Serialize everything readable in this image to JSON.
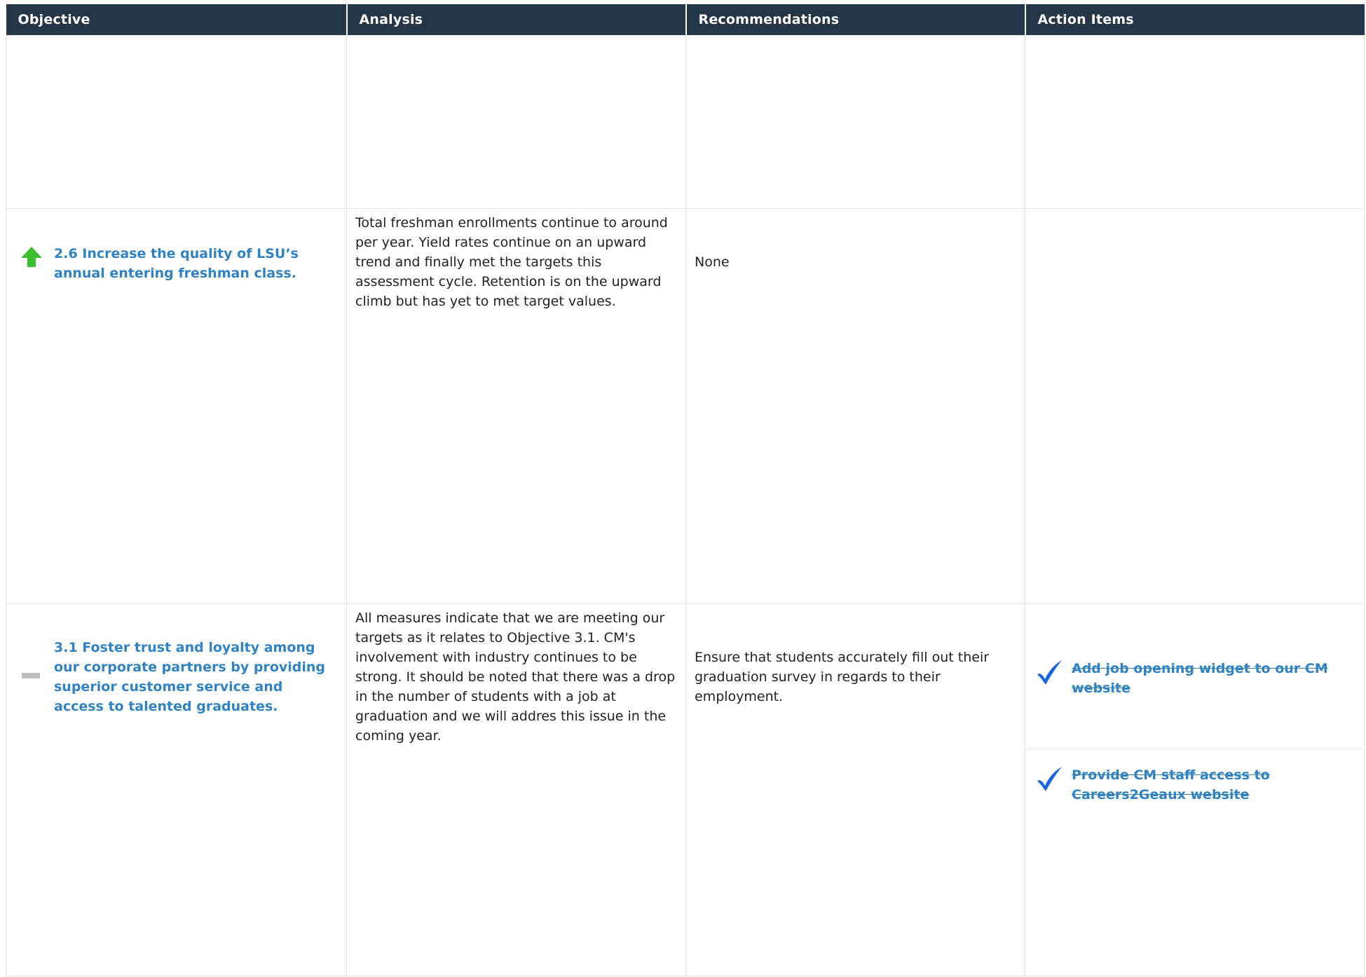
{
  "columns": [
    "Objective",
    "Analysis",
    "Recommendations",
    "Action Items"
  ],
  "rows": [
    {
      "objective": "",
      "analysis": "",
      "recommendations": "",
      "actions": []
    },
    {
      "status_icon": "up-arrow-icon",
      "status_color": "#3cbf2e",
      "objective": "2.6 Increase the quality of LSU’s annual entering freshman class.",
      "analysis": "Total freshman enrollments continue to around per year.    Yield rates continue on an upward trend and finally met the targets this assessment cycle.  Retention is on the upward climb but has yet to met target values.",
      "recommendations": "None",
      "actions": []
    },
    {
      "status_icon": "dash-icon",
      "status_color": "#bdbdbd",
      "objective": "3.1 Foster trust and loyalty among our corporate partners by providing superior customer service and access to talented graduates.",
      "analysis": "All measures indicate that we are meeting our targets as it relates to Objective 3.1.  CM's involvement with industry continues to be strong.  It should be noted that there was a drop in the number of students with a job at graduation and we will addres this issue in the coming year.",
      "recommendations": "Ensure that students accurately fill out their graduation survey in regards to their employment.",
      "actions": [
        {
          "label": "Add job opening widget to our CM website",
          "icon": "checkmark-icon",
          "status": "completed"
        },
        {
          "label": "Provide CM staff access to Careers2Geaux website",
          "icon": "checkmark-icon",
          "status": "completed"
        }
      ]
    }
  ],
  "colors": {
    "header_bg": "#243648",
    "link": "#2f82c6",
    "check": "#1565e0",
    "border": "#e3e3e3"
  }
}
